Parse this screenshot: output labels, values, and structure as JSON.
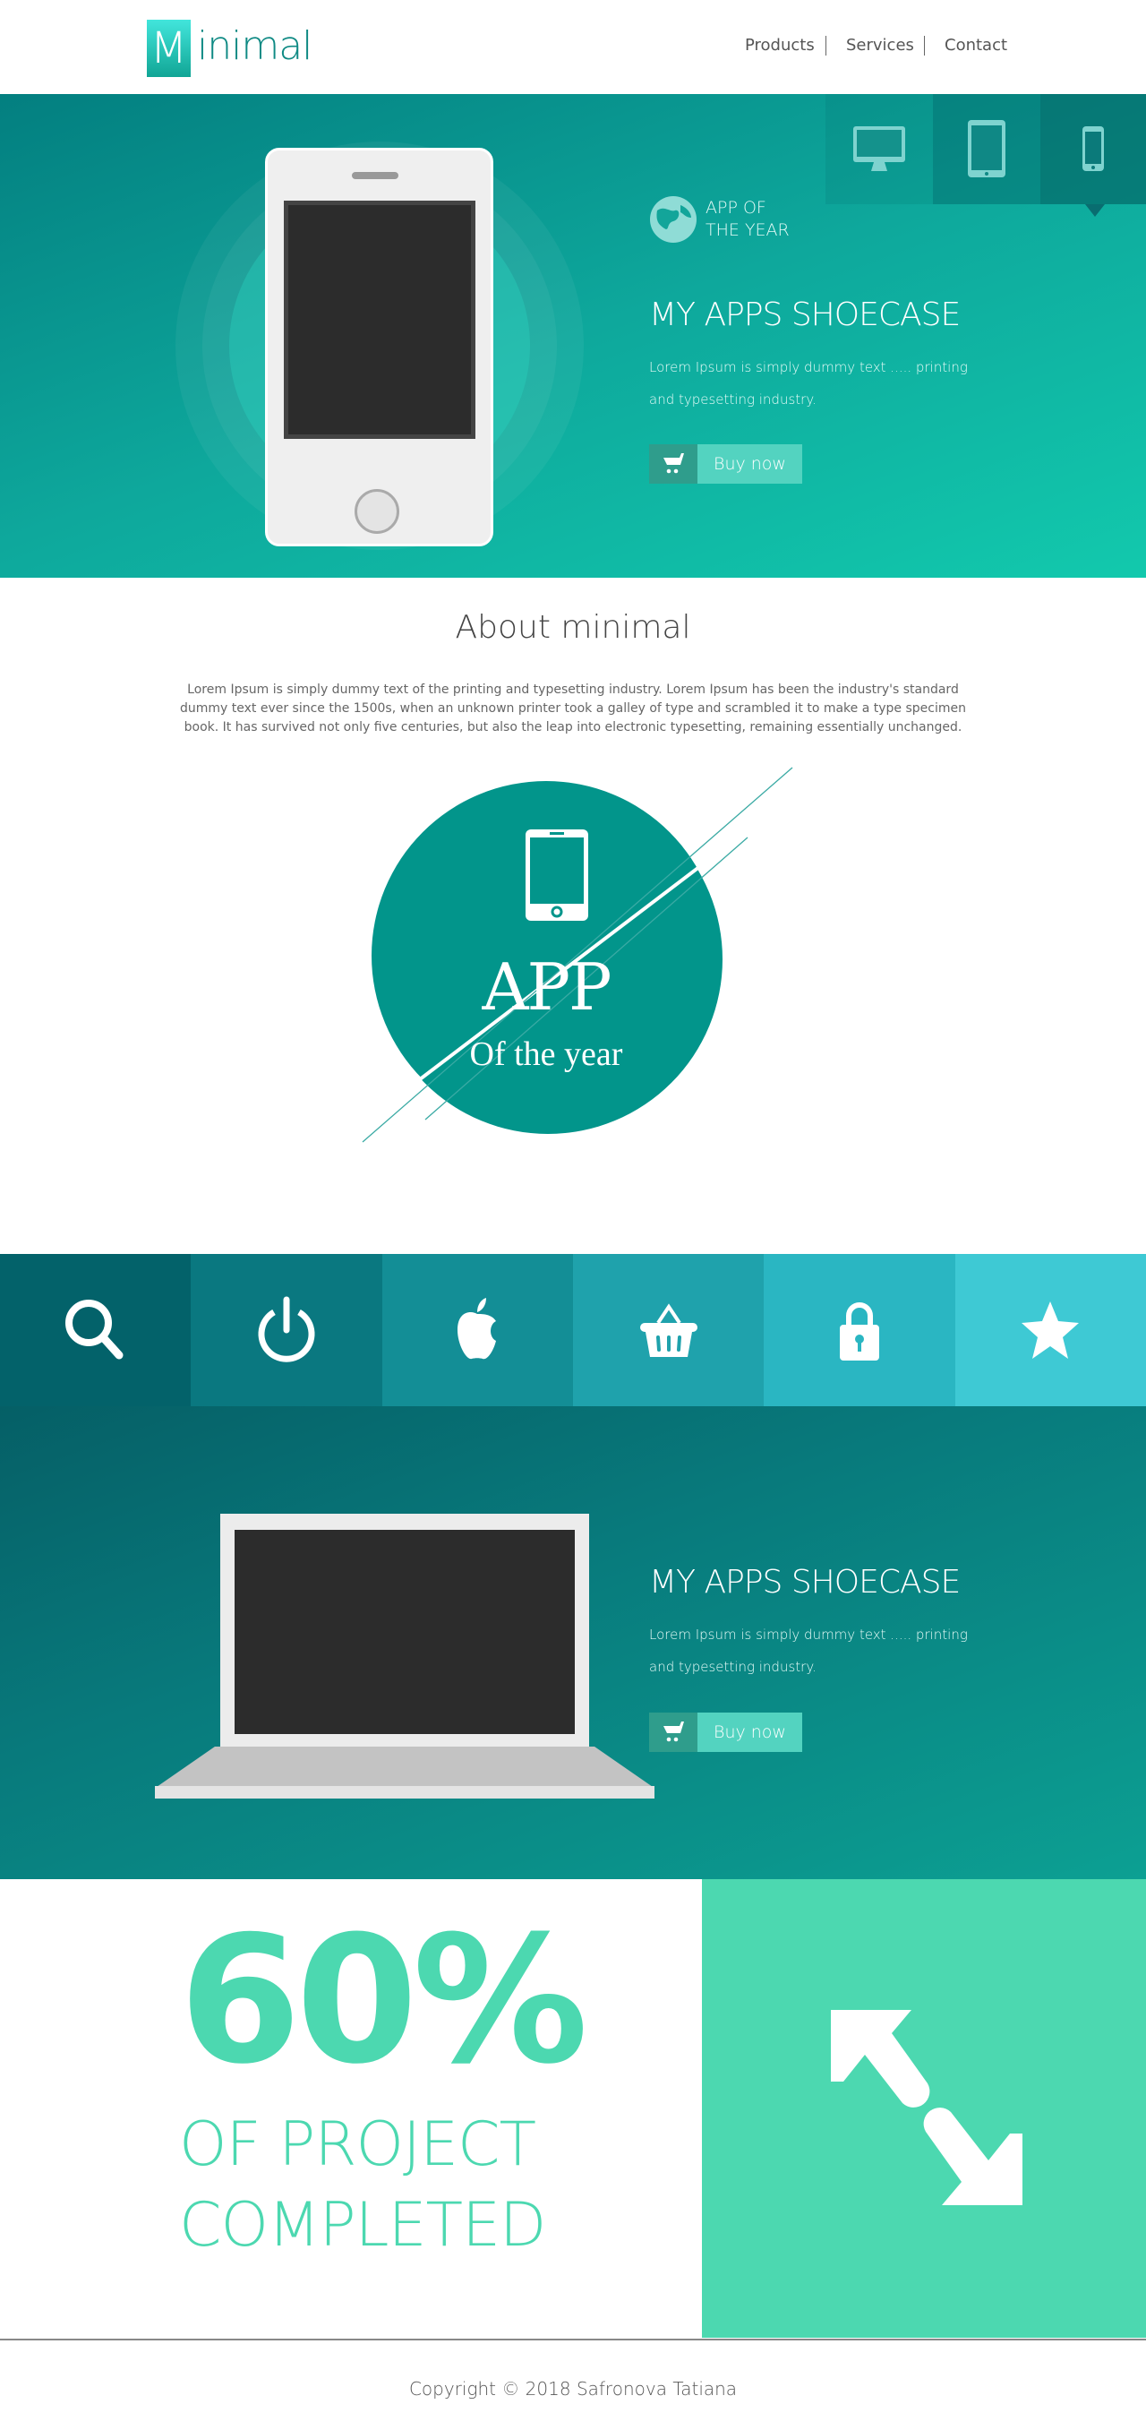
{
  "header": {
    "logo_letter": "M",
    "logo_rest": "inimal",
    "nav": [
      "Products",
      "Services",
      "Contact"
    ]
  },
  "hero": {
    "device_tabs": [
      "desktop",
      "tablet",
      "phone"
    ],
    "active_tab": "phone",
    "badge_line1": "APP OF",
    "badge_line2": "THE YEAR",
    "title": "MY APPS SHOECASE",
    "lorem1": "Lorem Ipsum is simply dummy text ..... printing",
    "lorem2": "and typesetting industry.",
    "buy_label": "Buy now"
  },
  "about": {
    "title": "About minimal",
    "text": "Lorem Ipsum is simply dummy text of the printing and typesetting industry. Lorem Ipsum has been the industry's standard dummy text ever since the 1500s, when an unknown printer took a galley of type and scrambled it to make a type specimen book. It has survived not only five centuries, but also the leap into electronic typesetting, remaining essentially unchanged.",
    "badge_big": "APP",
    "badge_small": "Of the year"
  },
  "iconbar": {
    "icons": [
      "search-icon",
      "power-icon",
      "apple-icon",
      "basket-icon",
      "lock-icon",
      "star-icon"
    ],
    "colors": [
      "#03626a",
      "#0a7880",
      "#138e96",
      "#1fa2ac",
      "#2ab6c2",
      "#3ec9d4"
    ]
  },
  "hero2": {
    "title": "MY APPS SHOECASE",
    "lorem1": "Lorem Ipsum is simply dummy text ..... printing",
    "lorem2": "and typesetting industry.",
    "buy_label": "Buy now"
  },
  "stats": {
    "percent": "60%",
    "line1": "OF PROJECT",
    "line2": "COMPLETED",
    "progress_percent": 60
  },
  "footer": {
    "copyright": "Copyright © 2018 Safronova Tatiana"
  },
  "colors": {
    "teal": "#0a9c93",
    "mint": "#4cd8b0"
  }
}
